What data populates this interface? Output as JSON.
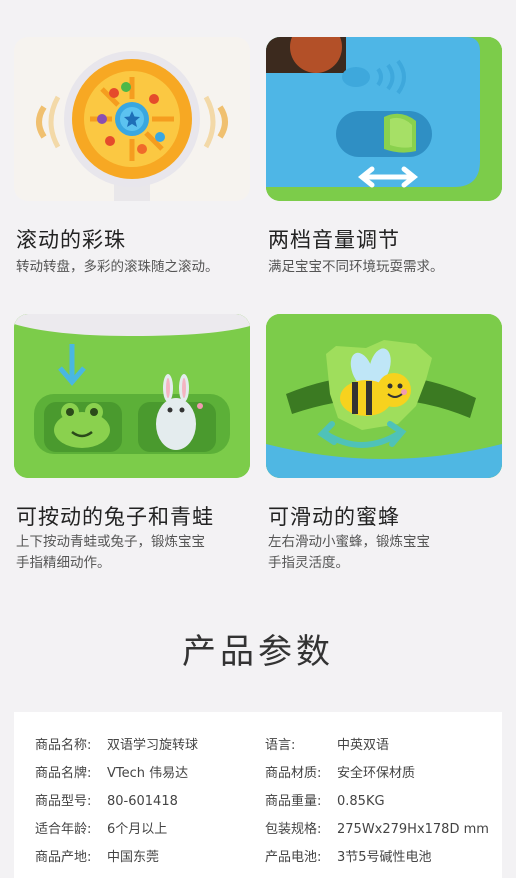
{
  "features": [
    {
      "title": "滚动的彩珠",
      "desc": "转动转盘，多彩的滚珠随之滚动。"
    },
    {
      "title": "两档音量调节",
      "desc": "满足宝宝不同环境玩耍需求。"
    },
    {
      "title": "可按动的兔子和青蛙",
      "desc_lines": [
        "上下按动青蛙或兔子，锻炼宝宝",
        "手指精细动作。"
      ]
    },
    {
      "title": "可滑动的蜜蜂",
      "desc_lines": [
        "左右滑动小蜜蜂，锻炼宝宝",
        "手指灵活度。"
      ]
    }
  ],
  "params": {
    "heading": "产品参数",
    "left": [
      {
        "label": "商品名称:",
        "value": "双语学习旋转球"
      },
      {
        "label": "商品名牌:",
        "value": "VTech 伟易达"
      },
      {
        "label": "商品型号:",
        "value": "80-601418"
      },
      {
        "label": "适合年龄:",
        "value": "6个月以上"
      },
      {
        "label": "商品产地:",
        "value": "中国东莞"
      }
    ],
    "right": [
      {
        "label": "语言:",
        "value": "中英双语"
      },
      {
        "label": "商品材质:",
        "value": "安全环保材质"
      },
      {
        "label": "商品重量:",
        "value": "0.85KG"
      },
      {
        "label": "包装规格:",
        "value": "275Wx279Hx178D mm"
      },
      {
        "label": "产品电池:",
        "value": "3节5号碱性电池"
      }
    ]
  }
}
